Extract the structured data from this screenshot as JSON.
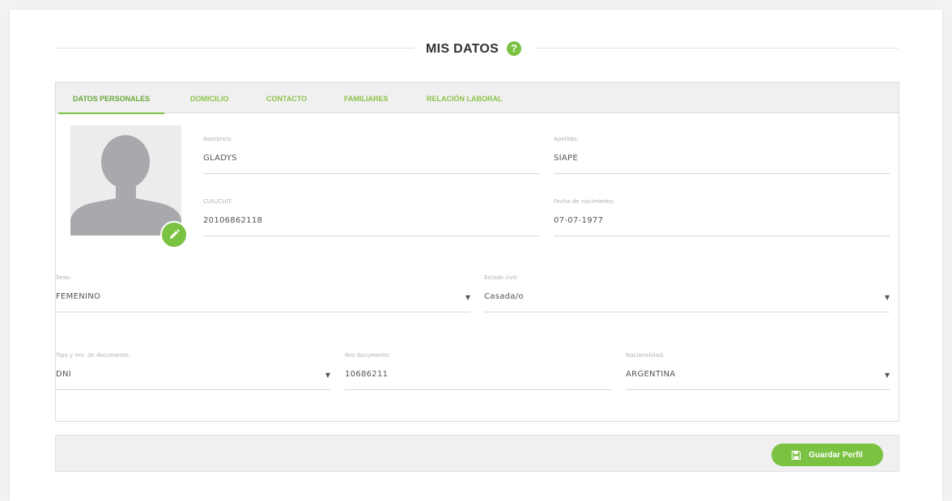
{
  "header": {
    "title": "MIS DATOS",
    "help_icon": "question-circle-icon"
  },
  "tabs": [
    {
      "label": "DATOS PERSONALES",
      "active": true
    },
    {
      "label": "DOMICILIO",
      "active": false
    },
    {
      "label": "CONTACTO",
      "active": false
    },
    {
      "label": "FAMILIARES",
      "active": false
    },
    {
      "label": "RELACIÓN LABORAL",
      "active": false
    }
  ],
  "avatar": {
    "icon": "user-silhouette-icon",
    "edit_icon": "pencil-icon"
  },
  "fields": {
    "nombre": {
      "label": "Nombre/s:",
      "value": "GLADYS"
    },
    "apellido": {
      "label": "Apellido:",
      "value": "SIAPE"
    },
    "cuil": {
      "label": "CUIL/CUIT:",
      "value": "20106862118"
    },
    "fecha_nacimiento": {
      "label": "Fecha de nacimiento:",
      "value": "07-07-1977"
    },
    "sexo": {
      "label": "Sexo:",
      "value": "FEMENINO"
    },
    "estado_civil": {
      "label": "Estado civil:",
      "value": "Casada/o"
    },
    "tipo_documento": {
      "label": "Tipo y nro. de documento:",
      "value": "DNI"
    },
    "nro_documento": {
      "label": "Nro documento:",
      "value": "10686211"
    },
    "nacionalidad": {
      "label": "Nacionalidad:",
      "value": "ARGENTINA"
    }
  },
  "footer": {
    "save_label": "Guardar Perfil",
    "save_icon": "floppy-disk-icon"
  },
  "colors": {
    "accent": "#7cc242",
    "tab_text": "#8bc34a",
    "bar_bg": "#f0f0f0"
  }
}
